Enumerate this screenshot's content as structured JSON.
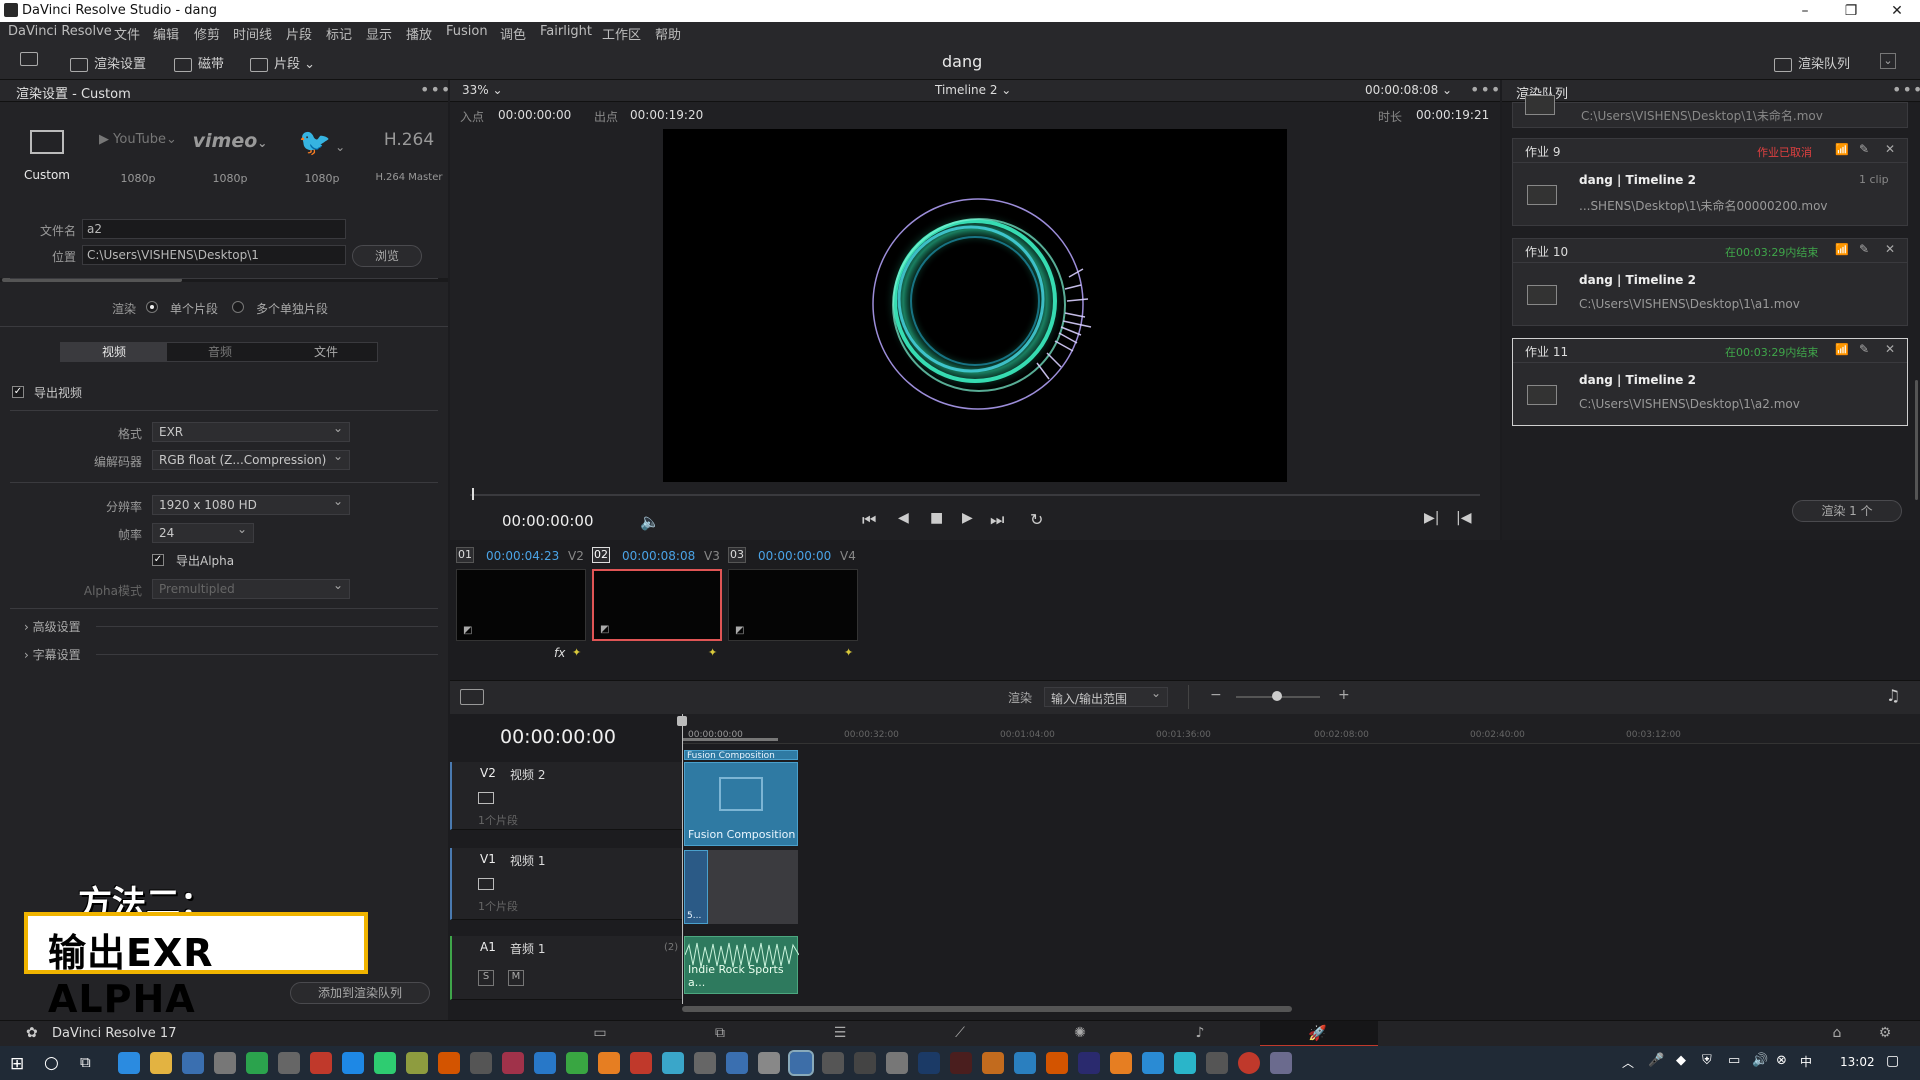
{
  "window": {
    "title": "DaVinci Resolve Studio - dang",
    "min": "–",
    "max": "❐",
    "close": "✕"
  },
  "menu": [
    "DaVinci Resolve",
    "文件",
    "编辑",
    "修剪",
    "时间线",
    "片段",
    "标记",
    "显示",
    "播放",
    "Fusion",
    "调色",
    "Fairlight",
    "工作区",
    "帮助"
  ],
  "toolbar": {
    "render_settings": "渲染设置",
    "tape": "磁带",
    "clips": "片段",
    "project": "dang",
    "render_queue": "渲染队列"
  },
  "render_settings": {
    "header": "渲染设置 - Custom",
    "presets": [
      {
        "name": "Custom",
        "sub": ""
      },
      {
        "name": "YouTube",
        "sub": "1080p"
      },
      {
        "name": "vimeo",
        "sub": "1080p"
      },
      {
        "name": "Twitter",
        "sub": "1080p"
      },
      {
        "name": "H.264",
        "sub": "H.264 Master"
      }
    ],
    "filename_label": "文件名",
    "filename": "a2",
    "location_label": "位置",
    "location": "C:\\Users\\VISHENS\\Desktop\\1",
    "browse": "浏览",
    "render_label": "渲染",
    "single_clip": "单个片段",
    "multiple_clips": "多个单独片段",
    "tabs": [
      "视频",
      "音频",
      "文件"
    ],
    "export_video": "导出视频",
    "format_label": "格式",
    "format": "EXR",
    "codec_label": "编解码器",
    "codec": "RGB float (Z...Compression)",
    "resolution_label": "分辨率",
    "resolution": "1920 x 1080 HD",
    "framerate_label": "帧率",
    "framerate": "24",
    "export_alpha": "导出Alpha",
    "alpha_mode_label": "Alpha模式",
    "alpha_mode": "Premultipled",
    "advanced": "高级设置",
    "subtitle": "字幕设置",
    "add_queue": "添加到渲染队列"
  },
  "viewer": {
    "zoom": "33%",
    "timeline": "Timeline 2",
    "timecode": "00:00:08:08",
    "in_label": "入点",
    "in": "00:00:00:00",
    "out_label": "出点",
    "out": "00:00:19:20",
    "dur_label": "时长",
    "dur": "00:00:19:21",
    "playhead": "00:00:00:00"
  },
  "render_queue": {
    "header": "渲染队列",
    "top_path": "C:\\Users\\VISHENS\\Desktop\\1\\未命名.mov",
    "jobs": [
      {
        "id": "作业 9",
        "status": "作业已取消",
        "status_color": "#e04040",
        "name": "dang | Timeline 2",
        "clips": "1 clip",
        "path": "...SHENS\\Desktop\\1\\未命名00000200.mov"
      },
      {
        "id": "作业 10",
        "status": "在00:03:29内结束",
        "status_color": "#3fa64a",
        "name": "dang | Timeline 2",
        "clips": "",
        "path": "C:\\Users\\VISHENS\\Desktop\\1\\a1.mov"
      },
      {
        "id": "作业 11",
        "status": "在00:03:29内结束",
        "status_color": "#3fa64a",
        "name": "dang | Timeline 2",
        "clips": "",
        "path": "C:\\Users\\VISHENS\\Desktop\\1\\a2.mov"
      }
    ],
    "render_btn": "渲染 1 个"
  },
  "clips": [
    {
      "num": "01",
      "tc": "00:00:04:23",
      "track": "V2"
    },
    {
      "num": "02",
      "tc": "00:00:08:08",
      "track": "V3"
    },
    {
      "num": "03",
      "tc": "00:00:00:00",
      "track": "V4"
    }
  ],
  "timeline": {
    "render_label": "渲染",
    "range": "输入/输出范围",
    "timecode": "00:00:00:00",
    "ruler": [
      "00:00:00:00",
      "00:00:32:00",
      "00:01:04:00",
      "00:01:36:00",
      "00:02:08:00",
      "00:02:40:00",
      "00:03:12:00"
    ],
    "tracks": [
      {
        "id": "V2",
        "name": "视频 2",
        "count": "1个片段"
      },
      {
        "id": "V1",
        "name": "视频 1",
        "count": "1个片段"
      },
      {
        "id": "A1",
        "name": "音频 1",
        "count": "(2)"
      }
    ],
    "clip_v2": "Fusion Composition",
    "clip_v2_top": "Fusion Composition",
    "clip_v1": "5...",
    "clip_a1": "Indie Rock Sports a...",
    "s": "S",
    "m": "M"
  },
  "overlay": {
    "line1": "方法二：",
    "line2": "输出EXR ALPHA"
  },
  "bottom": {
    "app": "DaVinci Resolve 17"
  },
  "taskbar": {
    "time": "13:02"
  }
}
